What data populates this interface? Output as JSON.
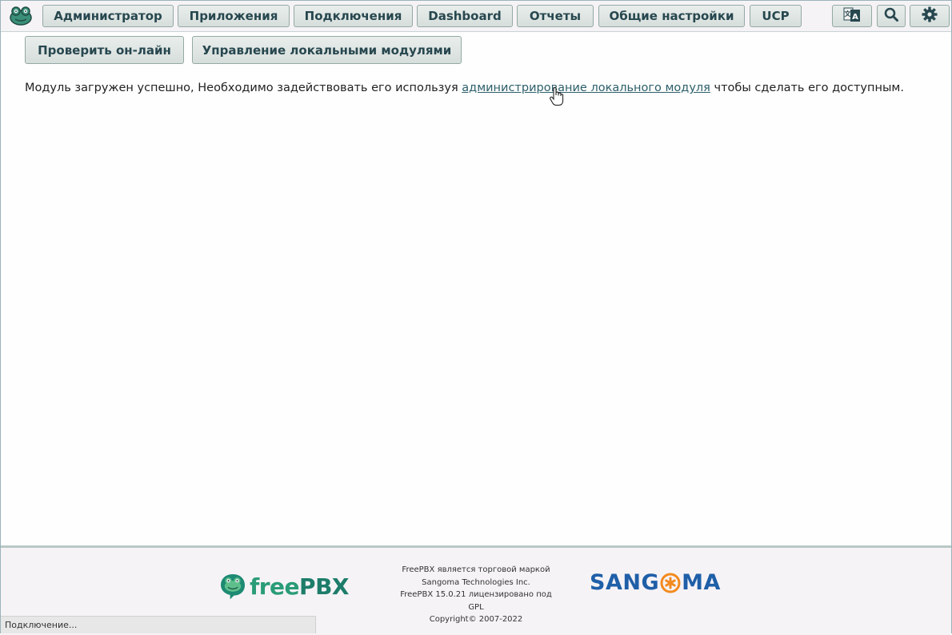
{
  "nav": {
    "items": [
      {
        "label": "Администратор"
      },
      {
        "label": "Приложения"
      },
      {
        "label": "Подключения"
      },
      {
        "label": "Dashboard"
      },
      {
        "label": "Отчеты"
      },
      {
        "label": "Общие настройки"
      },
      {
        "label": "UCP"
      }
    ],
    "icons": [
      "translate-icon",
      "search-icon",
      "gear-icon"
    ]
  },
  "actions": {
    "check_online": "Проверить он-лайн",
    "manage_local": "Управление локальными модулями"
  },
  "message": {
    "before": "Модуль загружен успешно, Необходимо задействовать его используя ",
    "link": "администрирование локального модуля",
    "after": " чтобы сделать его доступным."
  },
  "footer": {
    "brand_a": "free",
    "brand_b": "PBX",
    "legal_1": "FreePBX является торговой маркой",
    "legal_2": "Sangoma Technologies Inc.",
    "legal_3": "FreePBX 15.0.21 лицензировано под",
    "legal_4": "GPL",
    "legal_5": "Copyright© 2007-2022",
    "sangoma_a": "SANG",
    "sangoma_b": "MA"
  },
  "status": {
    "text": "Подключение..."
  },
  "colors": {
    "accent": "#27474f",
    "link": "#2d5f6b",
    "freepbx_green": "#2a9c77",
    "sangoma_blue": "#1f5fa8",
    "sangoma_orange": "#f28a1e"
  }
}
